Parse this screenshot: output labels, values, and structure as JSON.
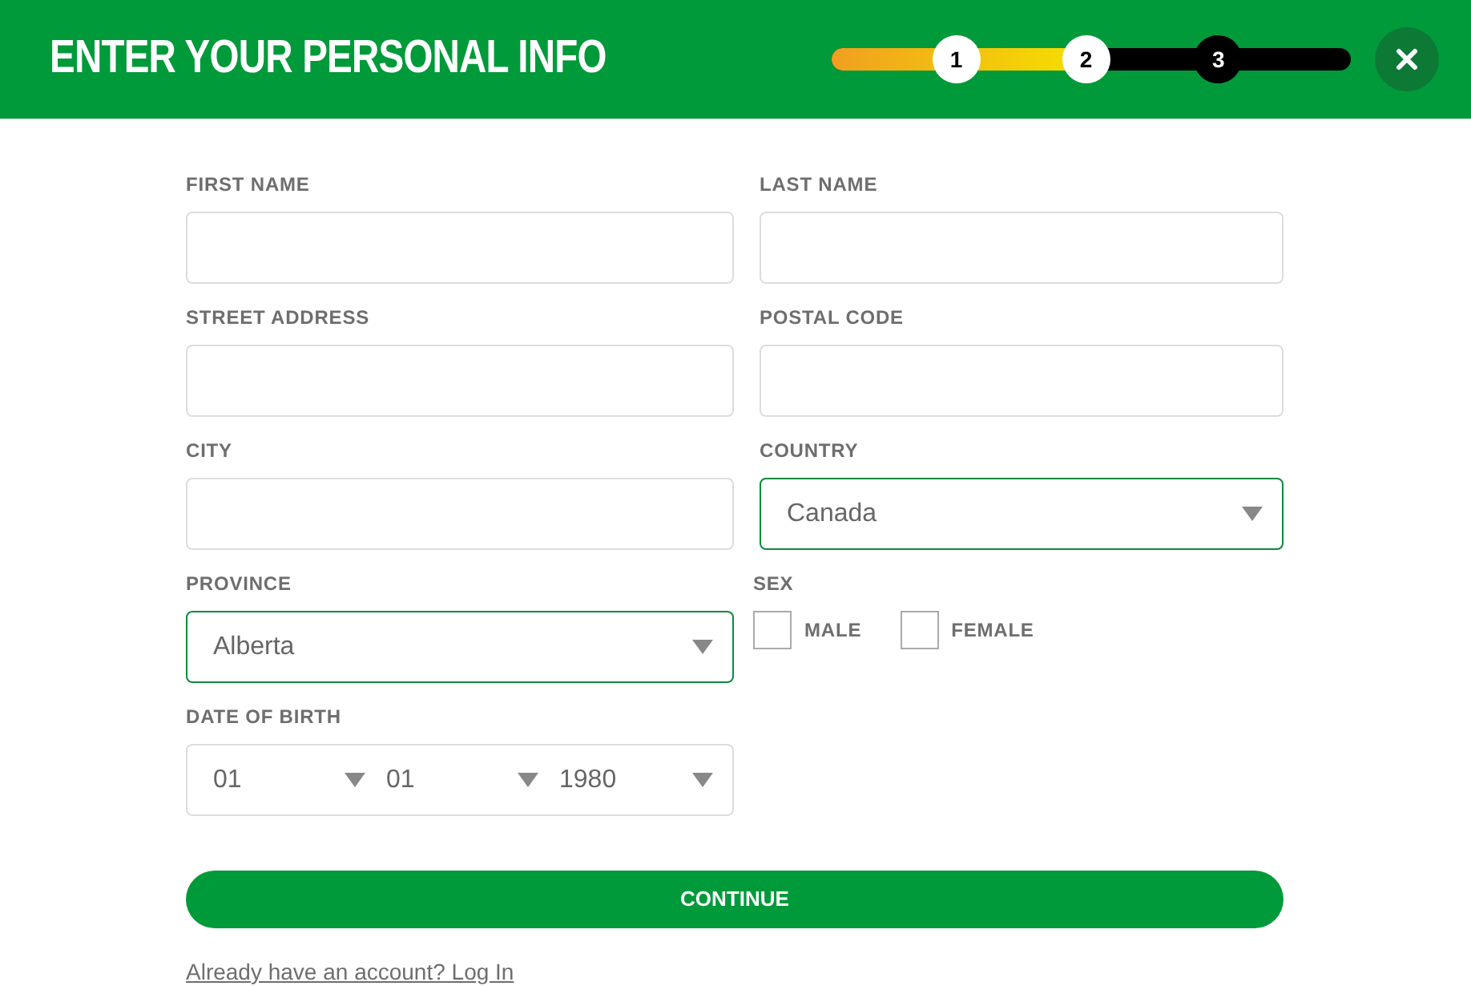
{
  "header": {
    "title": "ENTER YOUR PERSONAL INFO",
    "progress": {
      "level": 0.49,
      "steps": [
        {
          "label": "1",
          "current": false
        },
        {
          "label": "2",
          "current": false
        },
        {
          "label": "3",
          "current": true
        }
      ]
    }
  },
  "rows": [
    [
      {
        "kind": "text",
        "label": "FIRST NAME",
        "highlighted": false
      },
      {
        "kind": "text",
        "label": "LAST NAME",
        "highlighted": false
      }
    ],
    [
      {
        "kind": "text",
        "label": "STREET ADDRESS",
        "highlighted": false
      },
      {
        "kind": "text",
        "label": "POSTAL CODE",
        "highlighted": false
      }
    ],
    [
      {
        "kind": "text",
        "label": "CITY",
        "highlighted": false
      },
      {
        "kind": "select",
        "label": "COUNTRY",
        "value": "Canada",
        "highlighted": true
      }
    ],
    [
      {
        "kind": "select",
        "label": "PROVINCE",
        "value": "Alberta",
        "highlighted": true
      },
      {
        "kind": "checks",
        "label": "SEX",
        "options": [
          {
            "label": "MALE",
            "checked": false
          },
          {
            "label": "FEMALE",
            "checked": false
          }
        ]
      }
    ],
    [
      {
        "kind": "date",
        "label": "DATE OF BIRTH",
        "parts": [
          "01",
          "01",
          "1980"
        ]
      }
    ]
  ],
  "continue_button": "CONTINUE",
  "login_link": "Already have an account? Log In"
}
